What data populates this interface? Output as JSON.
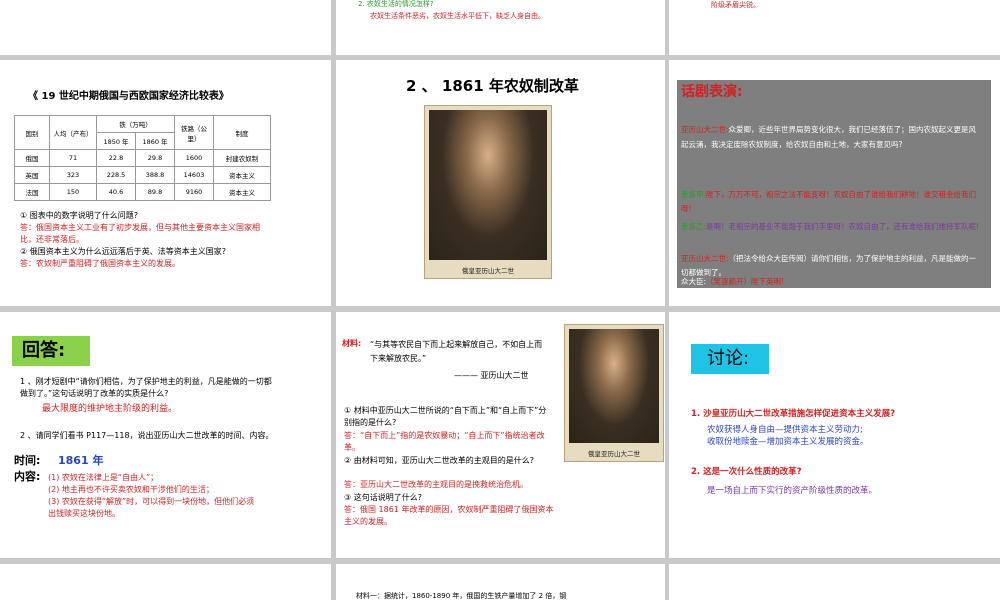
{
  "top_middle": {
    "line1": "2. 农奴生活的情况怎样?",
    "line2": "农奴生活条件恶劣，农奴生活水平低下，缺乏人身自由。"
  },
  "top_right": {
    "text": "阶级矛盾尖锐。"
  },
  "table_slide": {
    "title": "《 19 世纪中期俄国与西欧国家经济比较表》",
    "headers": [
      "国别",
      "人均（产布）",
      "铁（万吨）",
      "铁路（公里）",
      "制度"
    ],
    "subheaders": [
      "1850 年",
      "1860 年"
    ],
    "rows": [
      [
        "俄国",
        "71",
        "22.8",
        "29.8",
        "1600",
        "封建农奴制"
      ],
      [
        "英国",
        "323",
        "228.5",
        "388.8",
        "14603",
        "资本主义"
      ],
      [
        "法国",
        "150",
        "40.6",
        "89.8",
        "9160",
        "资本主义"
      ]
    ],
    "q1": "① 图表中的数字说明了什么问题?",
    "a1": "答：俄国资本主义工业有了初步发展，但与其他主要资本主义国家相比，还非常落后。",
    "q2": "② 俄国资本主义为什么远远落后于英、法等资本主义国家?",
    "a2": "答：农奴制严重阻碍了俄国资本主义的发展。"
  },
  "reform_slide": {
    "title": "2 、 1861 年农奴制改革",
    "caption": "俄皇亚历山大二世"
  },
  "drama_slide": {
    "title": "话剧表演:",
    "line1_speaker": "亚历山大二世:",
    "line1": "众爱卿，近些年世界局势变化很大，我们已经落伍了；国内农奴起义更是风起云涌，我决定废除农奴制度，给农奴自由和土地，大家有意见吗?",
    "line2_speaker": "贵族甲:",
    "line2": "陛下，万万不可，祖宗之法不能变呀！农奴自由了谁给我们耕地！谁交租金给我们呀!",
    "line3_speaker": "贵族乙:",
    "line3": "是啊！老祖宗的基业不能毁于我们手里呀！农奴自由了，还有谁给我们维持军队呢!",
    "line4_speaker": "亚历山大二世:",
    "line4": "（把法令给众大臣传阅）请你们相信，为了保护地主的利益，凡是能做的一切都做到了。",
    "line5_speaker": "众大臣:",
    "line5": "（笑逐颜开）陛下英明!"
  },
  "answer_slide": {
    "badge": "回答:",
    "q1": "1 、刚才短剧中“请你们相信，为了保护地主的利益，凡是能做的一切都做到了。”这句话说明了改革的实质是什么?",
    "a1": "最大限度的维护地主阶级的利益。",
    "q2": "2 、请同学们看书 P117—118，说出亚历山大二世改革的时间、内容。",
    "time_label": "时间:",
    "time_value": "1861 年",
    "content_label": "内容:",
    "c1": "(1) 农奴在法律上是“自由人”；",
    "c2": "(2) 地主再也不许买卖农奴和干涉他们的生活；",
    "c3": "(3) 农奴在获得“解放”时，可以得到一块份地，但他们必须出钱赎买这块份地。"
  },
  "material_slide": {
    "label": "材料:",
    "quote": "“与其等农民自下而上起来解放自己，不如自上而下来解放农民。”",
    "attribution": "——— 亚历山大二世",
    "caption": "俄皇亚历山大二世",
    "q1": "① 材料中亚历山大二世所说的“自下而上”和“自上而下”分别指的是什么?",
    "a1": "答：“自下而上”指的是农奴暴动；“自上而下”指统治者改革。",
    "q2": "② 由材料可知，亚历山大二世改革的主观目的是什么?",
    "a2": "答：亚历山大二世改革的主观目的是挽救统治危机。",
    "q3": "③ 这句话说明了什么?",
    "a3": "答：俄国 1861 年改革的原因，农奴制严重阻碍了俄国资本主义的发展。"
  },
  "discuss_slide": {
    "badge": "讨论:",
    "q1": "1. 沙皇亚历山大二世改革措施怎样促进资本主义发展?",
    "a1_1": "农奴获得人身自由—提供资本主义劳动力;",
    "a1_2": "收取份地赎金—增加资本主义发展的资金。",
    "q2": "2. 这是一次什么性质的改革?",
    "a2": "是一场自上而下实行的资产阶级性质的改革。"
  },
  "bottom_middle": {
    "text": "材料一：据统计，1860-1890 年，俄国的生铁产量增加了 2 倍，钢"
  }
}
